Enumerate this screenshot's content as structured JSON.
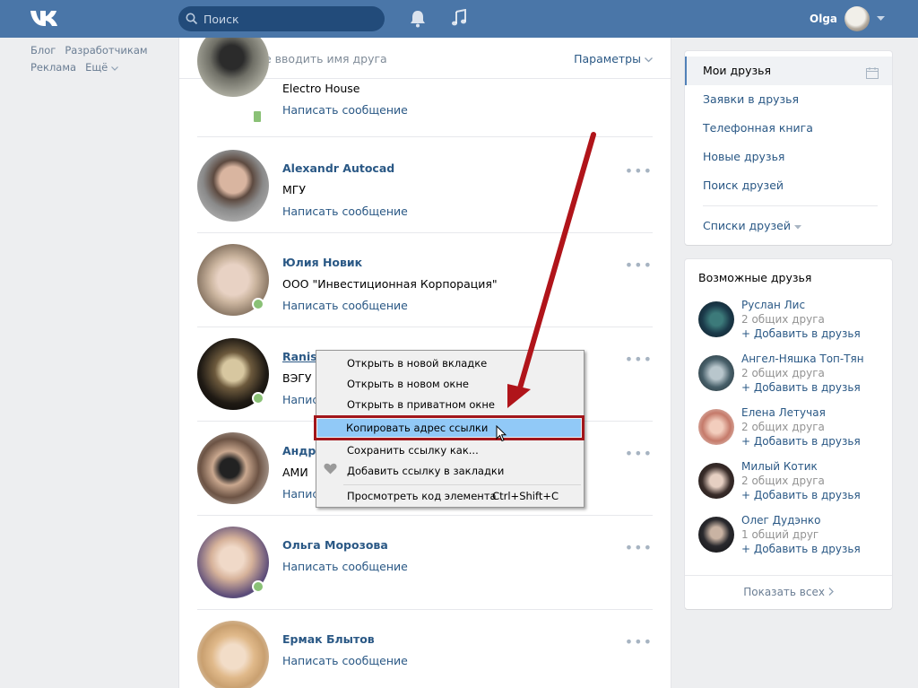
{
  "header": {
    "search_placeholder": "Поиск",
    "user_name": "Olga"
  },
  "left_links": {
    "blog": "Блог",
    "devs": "Разработчикам",
    "ads": "Реклама",
    "more": "Ещё"
  },
  "friends_search": {
    "placeholder": "Начните вводить имя друга",
    "params": "Параметры"
  },
  "friends": [
    {
      "name": "",
      "sub": "Electro House",
      "msg": "Написать сообщение"
    },
    {
      "name": "Alexandr Autocad",
      "sub": "МГУ",
      "msg": "Написать сообщение"
    },
    {
      "name": "Юлия Новик",
      "sub": "ООО \"Инвестиционная Корпорация\"",
      "msg": "Написать сообщение"
    },
    {
      "name": "Ranis Tagirov",
      "sub": "ВЭГУ (",
      "msg": "Написать сообщение"
    },
    {
      "name": "Андре",
      "sub": "АМИ",
      "msg": "Написать сообщение"
    },
    {
      "name": "Ольга Морозова",
      "msg": "Написать сообщение"
    },
    {
      "name": "Ермак Блытов",
      "msg": "Написать сообщение"
    }
  ],
  "right_menu": {
    "my_friends": "Мои друзья",
    "requests": "Заявки в друзья",
    "phonebook": "Телефонная книга",
    "new_friends": "Новые друзья",
    "find": "Поиск друзей",
    "lists": "Списки друзей"
  },
  "possible": {
    "title": "Возможные друзья",
    "add_label": "+ Добавить в друзья",
    "show_all": "Показать всех",
    "people": [
      {
        "name": "Руслан Лис",
        "mutual": "2 общих друга"
      },
      {
        "name": "Ангел-Няшка Топ-Тян",
        "mutual": "2 общих друга"
      },
      {
        "name": "Елена Летучая",
        "mutual": "2 общих друга"
      },
      {
        "name": "Милый Котик",
        "mutual": "2 общих друга"
      },
      {
        "name": "Олег Дудэнко",
        "mutual": "1 общий друг"
      }
    ]
  },
  "context_menu": {
    "open_tab": "Открыть в новой вкладке",
    "open_window": "Открыть в новом окне",
    "open_private": "Открыть в приватном окне",
    "copy_link": "Копировать адрес ссылки",
    "save_link": "Сохранить ссылку как...",
    "bookmark": "Добавить ссылку в закладки",
    "inspect": "Просмотреть код элемента",
    "inspect_shortcut": "Ctrl+Shift+C"
  },
  "colors": {
    "header": "#4a76a8",
    "link": "#2a5885",
    "online": "#8ac176",
    "highlight_border": "#a2161b",
    "arrow": "#b0141a"
  }
}
